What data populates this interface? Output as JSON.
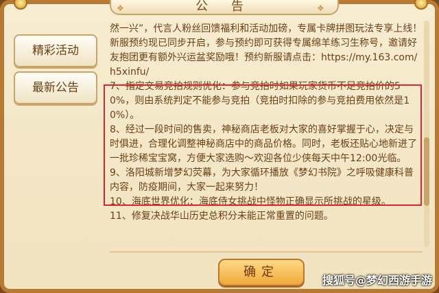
{
  "window": {
    "title": "公 告"
  },
  "sidebar": {
    "items": [
      {
        "label": "精彩活动"
      },
      {
        "label": "最新公告"
      }
    ]
  },
  "notice": {
    "paragraphs": [
      "然一兴”，代言人粉丝回馈福利和活动加磅，专属卡牌拼图玩法专享上线！新服预约现已同步开启，参与预约即可获得专属绵羊练习生称号，邀请好友抱团更有额外兴运盆奖励哦！预约新服请点击：https://my.163.com/h5xinfu/",
      "7、指定交易竞拍规则优化：参与竞拍时如果玩家货币不足竞拍价的50%，则由系统判定不能参与竞拍（竞拍时扣除的参与竞拍费用依然是10%）。",
      "8、经过一段时间的售卖，神秘商店老板对大家的喜好掌握于心，决定与时俱进，合理化调整神秘商店中的商品价格。同时，老板还贴心地新进了一批珍稀宝宝窝，方便大家选购～欢迎各位少侠每天中午12:00光临。",
      "9、洛阳城新增梦幻荧幕，为大家循环播放《梦幻书院》之呼吸健康科普内容，防疫期间，大家一起来努力！",
      "10、海底世界优化：海底侍女挑战中怪物正确显示所挑战的星级。",
      "11、修复决战华山历史总积分未能正常重置的问题。"
    ]
  },
  "footer": {
    "confirm_label": "确定"
  },
  "watermark": {
    "text": "搜狐号@梦幻西游手游"
  }
}
